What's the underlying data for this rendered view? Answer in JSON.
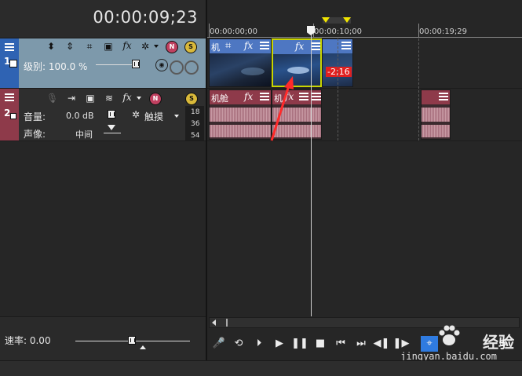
{
  "timeline": {
    "timecode": "00:00:09;23",
    "ruler_labels": [
      "00:00:00;00",
      "00:00:10;00",
      "00:00:19;29"
    ]
  },
  "video_track": {
    "number": "1",
    "level_label": "级别: 100.0 %",
    "color": "#7d99ab"
  },
  "audio_track": {
    "number": "2",
    "volume_label": "音量:",
    "volume_value": "0.0 dB",
    "pan_label": "声像:",
    "pan_value": "中间",
    "touch_label": "触摸",
    "db_scale": [
      "18",
      "36",
      "54"
    ],
    "color": "#8e3a4a"
  },
  "video_clips": [
    {
      "title": "机",
      "badge": ""
    },
    {
      "title": "",
      "badge": ""
    },
    {
      "title": "",
      "badge": "-2;16"
    }
  ],
  "audio_clips": [
    {
      "title": "机舱"
    },
    {
      "title": "机"
    },
    {
      "title": ""
    },
    {
      "title": ""
    }
  ],
  "bottom": {
    "rate_label": "速率: 0.00"
  },
  "watermark": {
    "text": "经验",
    "url": "jingyan.baidu.com"
  },
  "icons": [
    "menu-icon",
    "track-motion-icon",
    "crop-icon",
    "fx-icon",
    "compositing-icon",
    "solo-icon",
    "mute-icon",
    "record-icon",
    "play-icon",
    "pause-icon",
    "stop-icon"
  ]
}
